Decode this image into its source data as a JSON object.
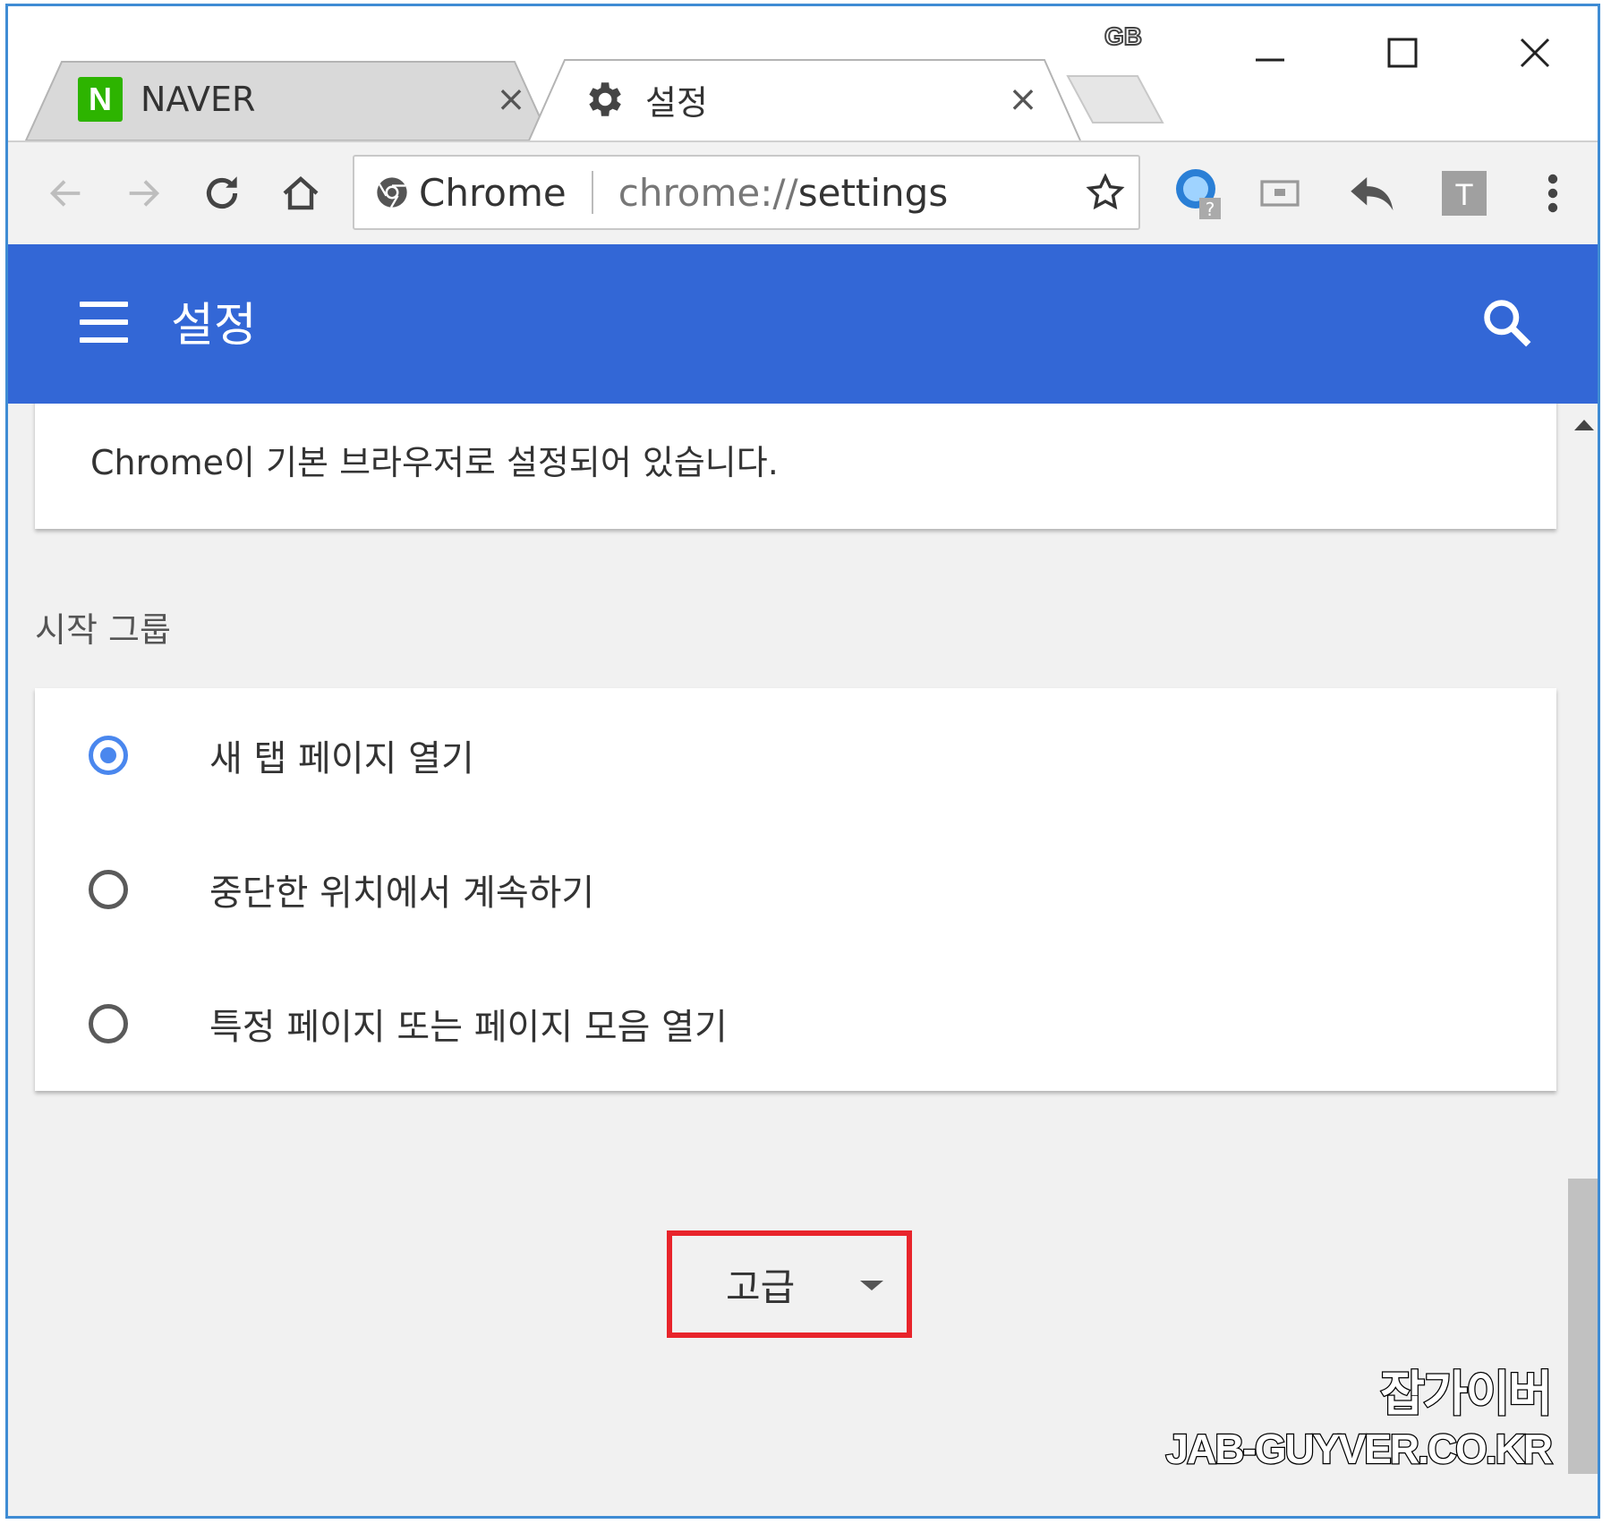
{
  "tabs": [
    {
      "title": "NAVER",
      "icon": "naver-icon",
      "active": false
    },
    {
      "title": "설정",
      "icon": "gear-icon",
      "active": true
    }
  ],
  "titlebar": {
    "badge": "GB"
  },
  "omnibox": {
    "chip": "Chrome",
    "url_scheme": "chrome://",
    "url_path": "settings"
  },
  "header": {
    "title": "설정"
  },
  "default_browser": {
    "text": "Chrome이 기본 브라우저로 설정되어 있습니다."
  },
  "startup": {
    "section_title": "시작 그룹",
    "options": [
      {
        "label": "새 탭 페이지 열기",
        "checked": true
      },
      {
        "label": "중단한 위치에서 계속하기",
        "checked": false
      },
      {
        "label": "특정 페이지 또는 페이지 모음 열기",
        "checked": false
      }
    ]
  },
  "advanced": {
    "label": "고급"
  },
  "watermark": {
    "korean": "잡가이버",
    "domain": "JAB-GUYVER.CO.KR"
  },
  "colors": {
    "header_blue": "#3367d6",
    "radio_blue": "#4a87ee",
    "highlight_red": "#e8242b",
    "naver_green": "#2db400"
  }
}
